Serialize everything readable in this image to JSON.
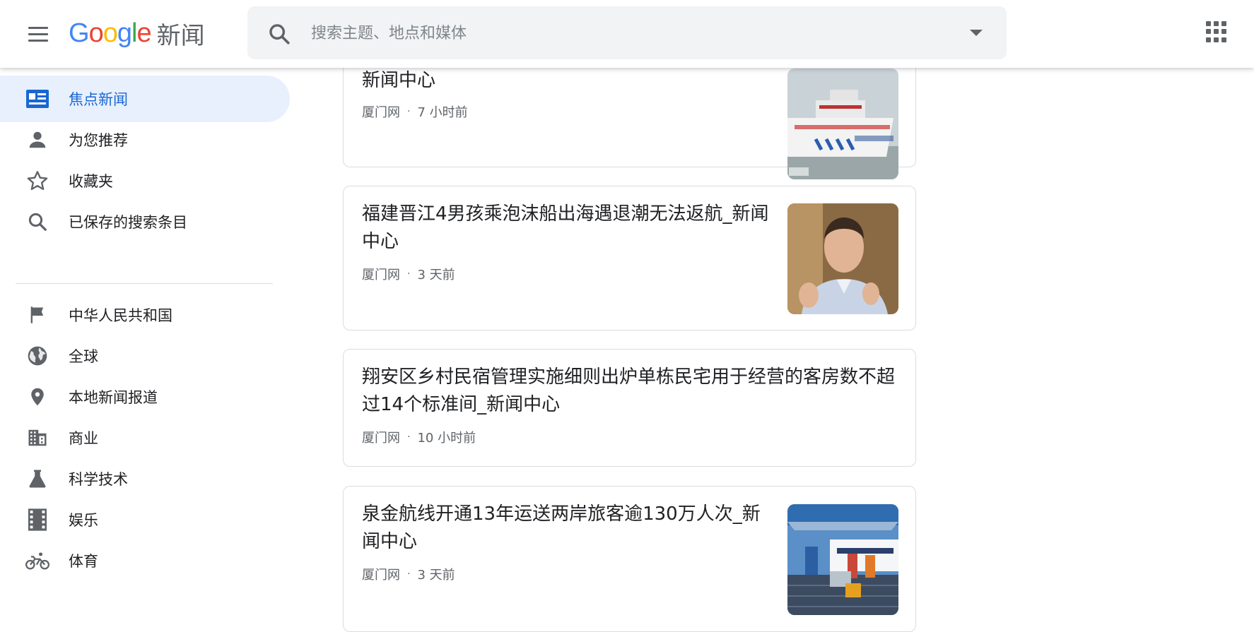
{
  "header": {
    "logo": {
      "letters": [
        "G",
        "o",
        "o",
        "g",
        "l",
        "e"
      ],
      "product": "新闻"
    },
    "search": {
      "placeholder": "搜索主题、地点和媒体",
      "value": ""
    },
    "menu_icon": "hamburger-menu-icon",
    "apps_icon": "apps-grid-icon"
  },
  "sidebar": {
    "primary": [
      {
        "label": "焦点新闻",
        "icon": "newspaper-icon",
        "active": true
      },
      {
        "label": "为您推荐",
        "icon": "person-icon",
        "active": false
      },
      {
        "label": "收藏夹",
        "icon": "star-icon",
        "active": false
      },
      {
        "label": "已保存的搜索条目",
        "icon": "search-icon",
        "active": false
      }
    ],
    "sections": [
      {
        "label": "中华人民共和国",
        "icon": "flag-icon"
      },
      {
        "label": "全球",
        "icon": "globe-icon"
      },
      {
        "label": "本地新闻报道",
        "icon": "location-pin-icon"
      },
      {
        "label": "商业",
        "icon": "business-building-icon"
      },
      {
        "label": "科学技术",
        "icon": "flask-icon"
      },
      {
        "label": "娱乐",
        "icon": "film-icon"
      },
      {
        "label": "体育",
        "icon": "bicycle-icon"
      }
    ]
  },
  "feed": {
    "articles": [
      {
        "title": "新闻中心",
        "source": "厦门网",
        "time": "7 小时前",
        "thumbnail": "ship-photo"
      },
      {
        "title": "福建晋江4男孩乘泡沫船出海遇退潮无法返航_新闻中心",
        "source": "厦门网",
        "time": "3 天前",
        "thumbnail": "portrait-photo"
      },
      {
        "title": "翔安区乡村民宿管理实施细则出炉单栋民宅用于经营的客房数不超过14个标准间_新闻中心",
        "source": "厦门网",
        "time": "10 小时前",
        "thumbnail": null
      },
      {
        "title": "泉金航线开通13年运送两岸旅客逾130万人次_新闻中心",
        "source": "厦门网",
        "time": "3 天前",
        "thumbnail": "ferry-dock-photo"
      }
    ],
    "separator": "·"
  },
  "colors": {
    "accent": "#1967d2",
    "active_bg": "#e8f0fe",
    "icon_gray": "#5f6368",
    "border": "#dadce0"
  }
}
